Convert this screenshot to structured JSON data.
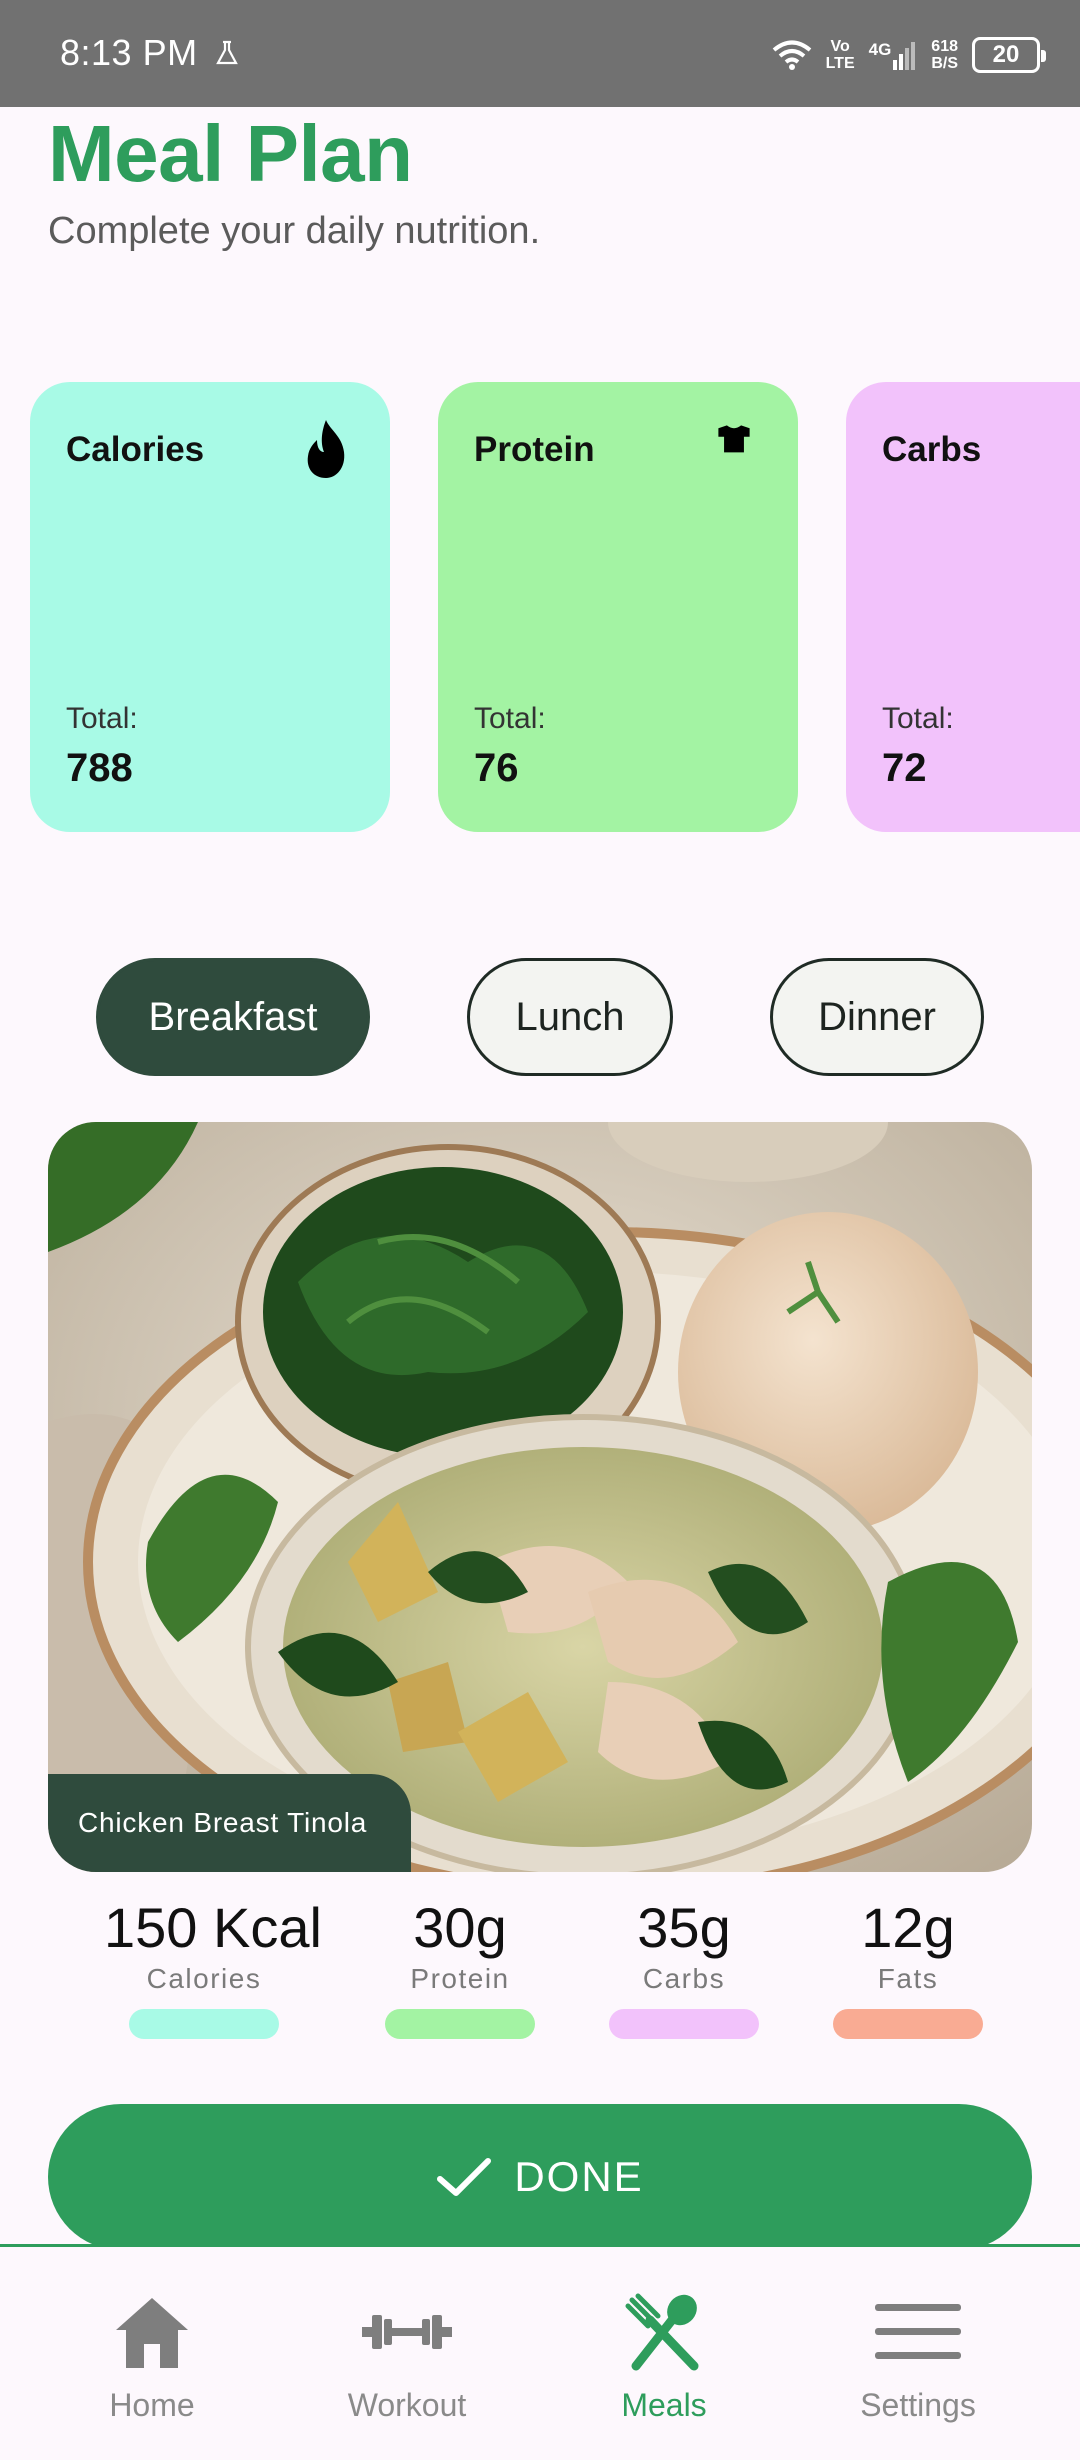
{
  "status_bar": {
    "time": "8:13 PM",
    "net_top": "Vo",
    "net_bottom": "LTE",
    "signal": "4G",
    "speed_top": "618",
    "speed_bottom": "B/S",
    "battery": "20"
  },
  "header": {
    "title": "Meal Plan",
    "subtitle": "Complete your daily nutrition."
  },
  "cards": [
    {
      "title": "Calories",
      "icon": "flame-icon",
      "total_label": "Total:",
      "total": "788",
      "color": "#a8fae6"
    },
    {
      "title": "Protein",
      "icon": "shirt-icon",
      "total_label": "Total:",
      "total": "76",
      "color": "#a3f3a3"
    },
    {
      "title": "Carbs",
      "icon": "",
      "total_label": "Total:",
      "total": "72",
      "color": "#f2c2fb"
    }
  ],
  "meal_tabs": {
    "selected": "Breakfast",
    "items": [
      "Breakfast",
      "Lunch",
      "Dinner"
    ]
  },
  "meal": {
    "name": "Chicken Breast Tinola",
    "macros": [
      {
        "value": "150 Kcal",
        "label": "Calories",
        "color": "#a8fae6"
      },
      {
        "value": "30g",
        "label": "Protein",
        "color": "#a3f3a3"
      },
      {
        "value": "35g",
        "label": "Carbs",
        "color": "#f2c2fb"
      },
      {
        "value": "12g",
        "label": "Fats",
        "color": "#f9ab93"
      }
    ]
  },
  "done_button": {
    "label": "DONE"
  },
  "bottom_nav": {
    "active": "Meals",
    "items": [
      {
        "label": "Home",
        "icon": "home-icon"
      },
      {
        "label": "Workout",
        "icon": "dumbbell-icon"
      },
      {
        "label": "Meals",
        "icon": "fork-spoon-icon"
      },
      {
        "label": "Settings",
        "icon": "menu-icon"
      }
    ]
  }
}
